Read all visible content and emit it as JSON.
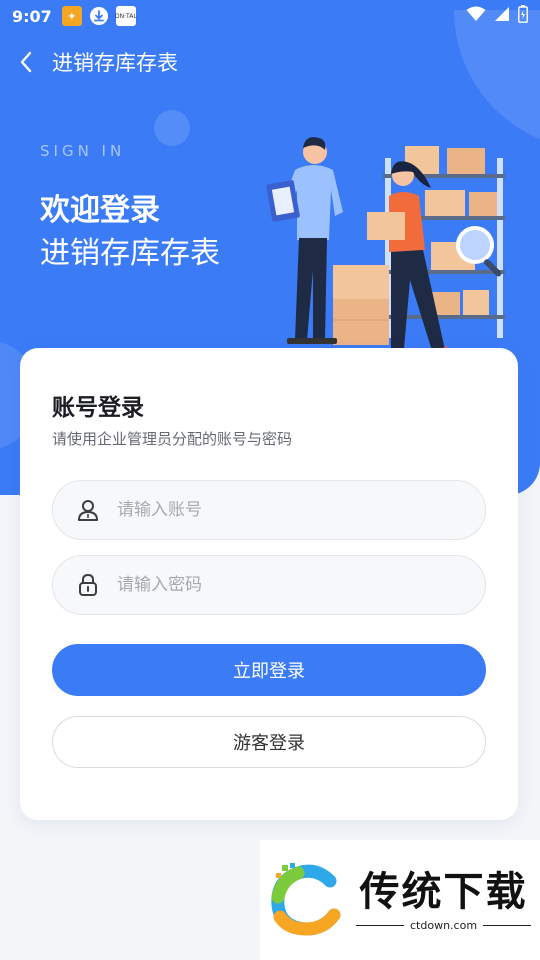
{
  "status_bar": {
    "time": "9:07",
    "notif_icons": [
      "app-notification-icon",
      "download-icon",
      "news-notification-icon"
    ],
    "notif_3_text": "ON·TAL",
    "right_icons": [
      "wifi-icon",
      "signal-icon",
      "battery-icon"
    ]
  },
  "title_bar": {
    "back_icon": "chevron-left-icon",
    "title": "进销存库存表"
  },
  "hero": {
    "sign_in": "SIGN IN",
    "welcome": "欢迎登录",
    "subtitle": "进销存库存表",
    "illustration": "warehouse-workers-illustration"
  },
  "login_card": {
    "title": "账号登录",
    "description": "请使用企业管理员分配的账号与密码",
    "account_field": {
      "placeholder": "请输入账号",
      "value": "",
      "icon": "user-icon"
    },
    "password_field": {
      "placeholder": "请输入密码",
      "value": "",
      "icon": "lock-icon"
    },
    "login_button": "立即登录",
    "guest_button": "游客登录"
  },
  "watermark": {
    "brand": "传统下载",
    "url": "ctdown.com"
  },
  "colors": {
    "primary": "#3b7cf6",
    "background": "#f3f5f9",
    "card": "#ffffff",
    "text": "#1b1d23",
    "muted": "#666a73",
    "placeholder": "#a6a9b0"
  }
}
